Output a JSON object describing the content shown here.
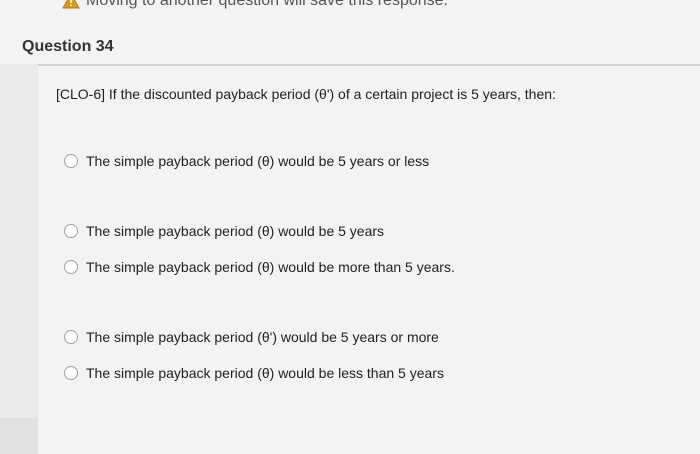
{
  "banner": {
    "warning_icon": "warning-triangle-icon",
    "text": "Moving to another question will save this response."
  },
  "question": {
    "title": "Question 34",
    "prompt": "[CLO-6] If the discounted payback period (θ') of a certain project is 5 years, then:",
    "options": [
      "The simple payback period (θ) would be 5 years or less",
      "The simple payback period (θ) would be 5 years",
      "The simple payback period (θ) would be more than 5 years.",
      "The simple payback period (θ') would be 5 years or more",
      "The simple payback period (θ) would be less than 5 years"
    ]
  }
}
